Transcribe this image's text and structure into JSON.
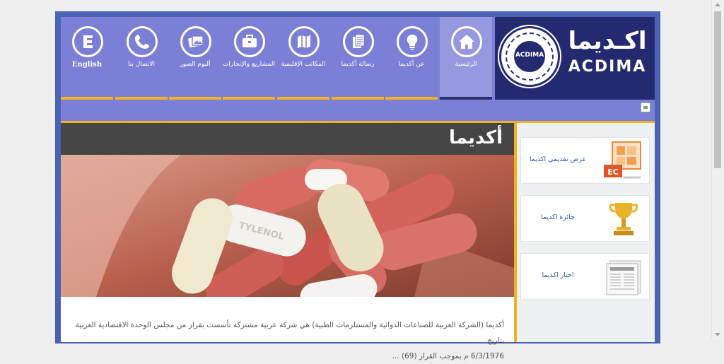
{
  "logo": {
    "arabic": "اكـديما",
    "latin": "ACDIMA",
    "seal_text": "ACDIMA"
  },
  "nav": {
    "items": [
      {
        "label": "English",
        "icon": "letter-e-icon"
      },
      {
        "label": "الاتصال بنا",
        "icon": "phone-icon"
      },
      {
        "label": "ألبوم الصور",
        "icon": "photo-album-icon"
      },
      {
        "label": "المشاريع والإنجازات",
        "icon": "briefcase-icon"
      },
      {
        "label": "المكاتب الإقليمية",
        "icon": "map-icon"
      },
      {
        "label": "رسالة أكديما",
        "icon": "documents-icon"
      },
      {
        "label": "عن أكديما",
        "icon": "lightbulb-icon"
      },
      {
        "label": "الرئيسية",
        "icon": "home-icon"
      }
    ],
    "active": "الرئيسية"
  },
  "main": {
    "title": "أكديما",
    "intro_line1": "أكديما (الشركة العربية للصناعات الدوائية والمستلزمات الطبية) هي شركة عربية مشتركة تأسست بقرار من مجلس الوحدة الاقتصادية العربية بتاريخ",
    "intro_line2": "6/3/1976 م بموجب القرار (69) ..."
  },
  "sidebar": {
    "items": [
      {
        "label": "عرض تقديمي اكديما",
        "icon": "presentation-icon"
      },
      {
        "label": "جائزة اكديما",
        "icon": "trophy-icon"
      },
      {
        "label": "اخبار اكديما",
        "icon": "newspaper-icon"
      }
    ]
  },
  "colors": {
    "frame": "#4a63b3",
    "nav_bg": "#7c7fd6",
    "nav_active": "#9699df",
    "logo_bg": "#242a70",
    "accent_gold": "#f2b21e",
    "title_bar": "#444444",
    "sidebar_link": "#2d57a5"
  }
}
